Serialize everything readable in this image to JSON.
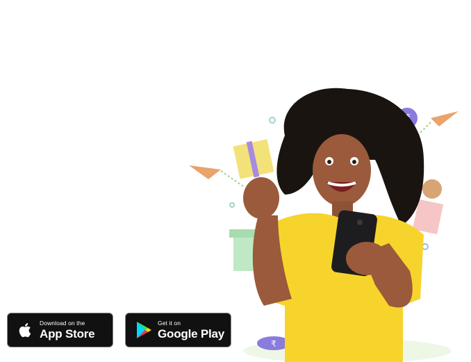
{
  "app_store_badge": {
    "small": "Download on the",
    "big": "App Store",
    "icon": "apple-icon"
  },
  "google_play_badge": {
    "small": "Get it on",
    "big": "Google Play",
    "icon": "google-play-icon"
  },
  "colors": {
    "badge_bg": "#111111",
    "shirt": "#f7d42c",
    "accent": "#8a7bdc"
  }
}
